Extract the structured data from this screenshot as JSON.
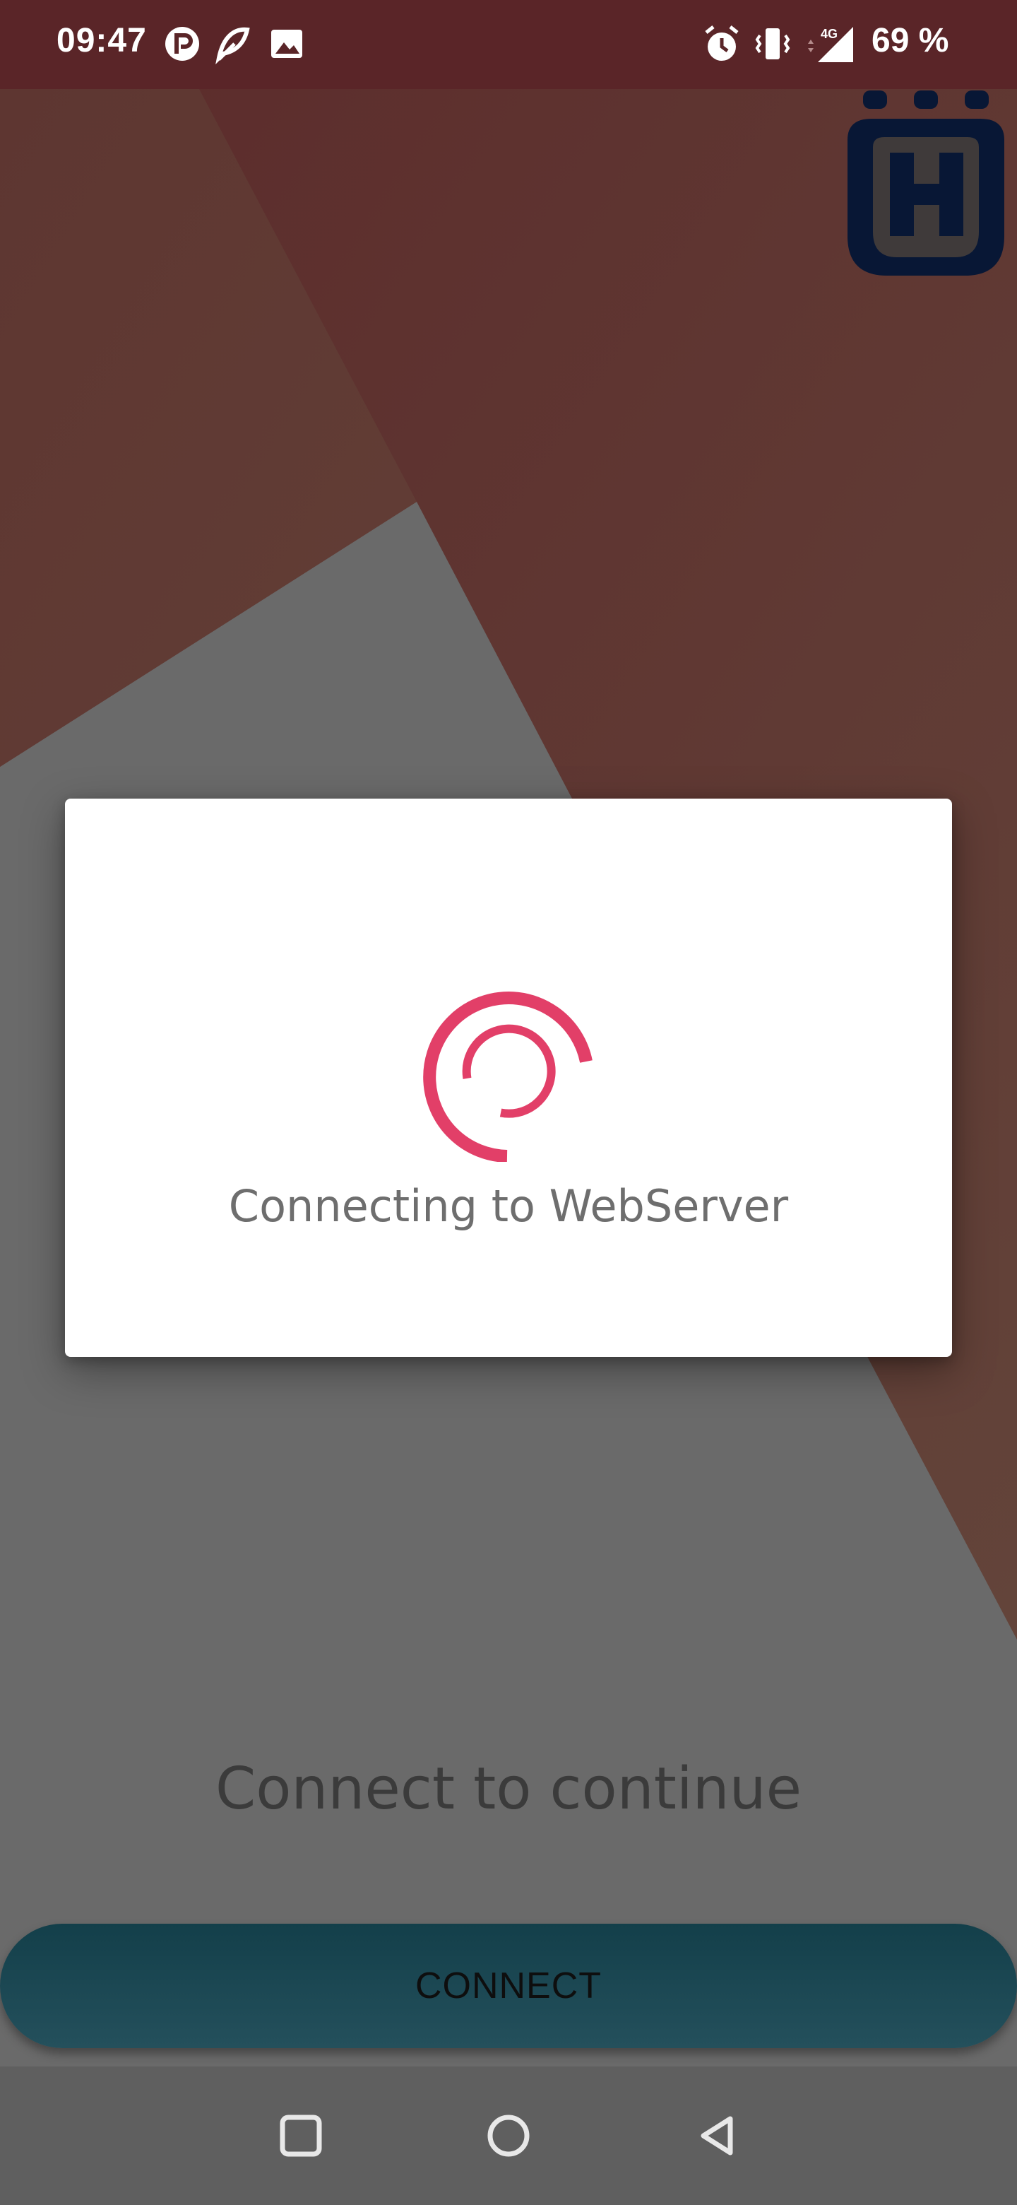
{
  "status_bar": {
    "time": "09:47",
    "battery_percent": "69 %",
    "network_type": "4G",
    "notification_icons": [
      "r-app-icon",
      "feather-app-icon",
      "gallery-icon"
    ],
    "system_icons": [
      "alarm-icon",
      "vibrate-icon",
      "signal-icon"
    ]
  },
  "dialog": {
    "message": "Connecting to WebServer",
    "spinner_color": "#e23f68"
  },
  "main": {
    "prompt": "Connect to continue",
    "connect_button_label": "CONNECT"
  },
  "navigation": {
    "buttons": [
      "recents-button",
      "home-button",
      "back-button"
    ]
  },
  "colors": {
    "status_bar": "#5a2528",
    "backdrop_dim": "#6a6a6a",
    "brand_logo": "#081735",
    "button": "#1b4651"
  }
}
